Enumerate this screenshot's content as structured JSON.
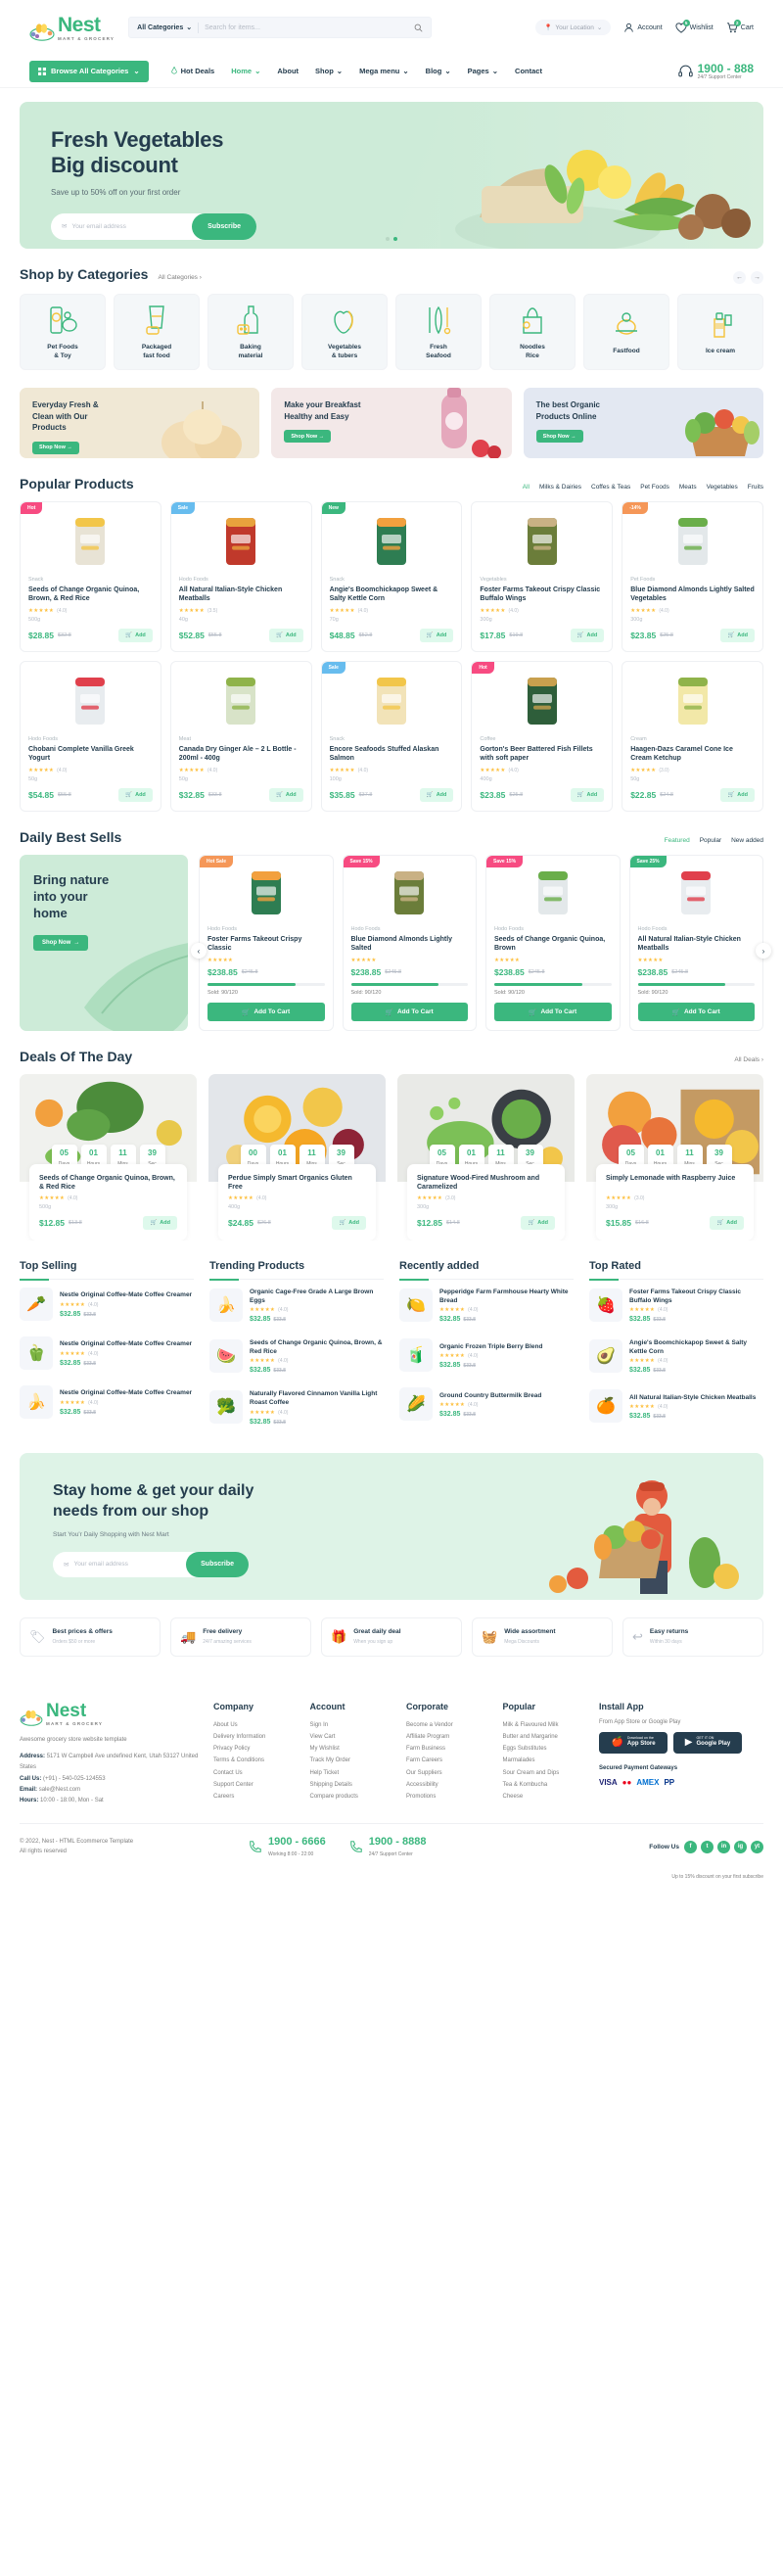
{
  "brand": {
    "name": "Nest",
    "tagline": "MART & GROCERY",
    "accent": "#3BB77E",
    "dark": "#253D4E"
  },
  "header": {
    "search": {
      "category": "All Categories",
      "placeholder": "Search for items..."
    },
    "location": "Your Location",
    "account": "Account",
    "wishlist": {
      "label": "Wishlist",
      "count": "5"
    },
    "cart": {
      "label": "Cart",
      "count": "2"
    }
  },
  "nav": {
    "browse": "Browse All Categories",
    "hot_deals": "Hot Deals",
    "items": [
      "Home",
      "About",
      "Shop",
      "Mega menu",
      "Blog",
      "Pages",
      "Contact"
    ],
    "phone": "1900 - 888",
    "phone_sub": "24/7 Support Center"
  },
  "hero": {
    "title_line1": "Fresh Vegetables",
    "title_line2": "Big discount",
    "subtitle": "Save up to 50% off on your first order",
    "email_placeholder": "Your email address",
    "subscribe": "Subscribe"
  },
  "categories_section": {
    "title": "Shop by Categories",
    "link": "All Categories",
    "items": [
      {
        "name": "Pet Foods\n& Toy",
        "icon": "pet-food-icon"
      },
      {
        "name": "Packaged\nfast food",
        "icon": "packaged-food-icon"
      },
      {
        "name": "Baking\nmaterial",
        "icon": "baking-icon"
      },
      {
        "name": "Vegetables\n& tubers",
        "icon": "vegetables-icon"
      },
      {
        "name": "Fresh\nSeafood",
        "icon": "seafood-icon"
      },
      {
        "name": "Noodles\nRice",
        "icon": "noodles-icon"
      },
      {
        "name": "Fastfood",
        "icon": "fastfood-icon"
      },
      {
        "name": "Ice cream",
        "icon": "icecream-icon"
      }
    ]
  },
  "promos": [
    {
      "title": "Everyday Fresh &\nClean with Our\nProducts",
      "button": "Shop Now",
      "bg": "#F0E8D5"
    },
    {
      "title": "Make your Breakfast\nHealthy and Easy",
      "button": "Shop Now",
      "bg": "#F3E8E8"
    },
    {
      "title": "The best Organic\nProducts Online",
      "button": "Shop Now",
      "bg": "#E3E8F2"
    }
  ],
  "popular": {
    "title": "Popular Products",
    "tabs": [
      "All",
      "Milks & Dairies",
      "Coffes & Teas",
      "Pet Foods",
      "Meats",
      "Vegetables",
      "Fruits"
    ],
    "active_tab": "All",
    "products": [
      {
        "tag": "Hot",
        "tag_color": "#F74B81",
        "cat": "Snack",
        "name": "Seeds of Change Organic Quinoa, Brown, & Red Rice",
        "stars": "★★★★★",
        "rating": "(4.0)",
        "weight": "500g",
        "price": "$28.85",
        "old": "$32.8"
      },
      {
        "tag": "Sale",
        "tag_color": "#67BCEE",
        "cat": "Hodo Foods",
        "name": "All Natural Italian-Style Chicken Meatballs",
        "stars": "★★★★★",
        "rating": "(3.5)",
        "weight": "40g",
        "price": "$52.85",
        "old": "$55.8"
      },
      {
        "tag": "New",
        "tag_color": "#3BB77E",
        "cat": "Snack",
        "name": "Angie's Boomchickapop Sweet & Salty Kettle Corn",
        "stars": "★★★★★",
        "rating": "(4.0)",
        "weight": "70g",
        "price": "$48.85",
        "old": "$52.8"
      },
      {
        "tag": "",
        "tag_color": "",
        "cat": "Vegetables",
        "name": "Foster Farms Takeout Crispy Classic Buffalo Wings",
        "stars": "★★★★★",
        "rating": "(4.0)",
        "weight": "300g",
        "price": "$17.85",
        "old": "$19.8"
      },
      {
        "tag": "-14%",
        "tag_color": "#F59758",
        "cat": "Pet Foods",
        "name": "Blue Diamond Almonds Lightly Salted Vegetables",
        "stars": "★★★★★",
        "rating": "(4.0)",
        "weight": "300g",
        "price": "$23.85",
        "old": "$25.8"
      },
      {
        "tag": "",
        "tag_color": "",
        "cat": "Hodo Foods",
        "name": "Chobani Complete Vanilla Greek Yogurt",
        "stars": "★★★★★",
        "rating": "(4.0)",
        "weight": "50g",
        "price": "$54.85",
        "old": "$55.8"
      },
      {
        "tag": "",
        "tag_color": "",
        "cat": "Meat",
        "name": "Canada Dry Ginger Ale – 2 L Bottle - 200ml - 400g",
        "stars": "★★★★★",
        "rating": "(4.0)",
        "weight": "50g",
        "price": "$32.85",
        "old": "$33.8"
      },
      {
        "tag": "Sale",
        "tag_color": "#67BCEE",
        "cat": "Snack",
        "name": "Encore Seafoods Stuffed Alaskan Salmon",
        "stars": "★★★★★",
        "rating": "(4.0)",
        "weight": "100g",
        "price": "$35.85",
        "old": "$37.8"
      },
      {
        "tag": "Hot",
        "tag_color": "#F74B81",
        "cat": "Coffee",
        "name": "Gorton's Beer Battered Fish Fillets with soft paper",
        "stars": "★★★★★",
        "rating": "(4.0)",
        "weight": "400g",
        "price": "$23.85",
        "old": "$25.8"
      },
      {
        "tag": "",
        "tag_color": "",
        "cat": "Cream",
        "name": "Haagen-Dazs Caramel Cone Ice Cream Ketchup",
        "stars": "★★★★★",
        "rating": "(3.0)",
        "weight": "50g",
        "price": "$22.85",
        "old": "$24.8"
      }
    ]
  },
  "daily": {
    "title": "Daily Best Sells",
    "tabs": [
      "Featured",
      "Popular",
      "New added"
    ],
    "active_tab": "Featured",
    "banner": {
      "title": "Bring nature\ninto your\nhome",
      "button": "Shop Now"
    },
    "products": [
      {
        "tag": "Hot Sale",
        "tag_color": "#F59758",
        "cat": "Hodo Foods",
        "name": "Foster Farms Takeout Crispy Classic",
        "stars": "★★★★★",
        "price": "$238.85",
        "old": "$245.8",
        "progress": 75,
        "sold": "Sold: 90/120",
        "button": "Add To Cart"
      },
      {
        "tag": "Save 15%",
        "tag_color": "#F74B81",
        "cat": "Hodo Foods",
        "name": "Blue Diamond Almonds Lightly Salted",
        "stars": "★★★★★",
        "price": "$238.85",
        "old": "$245.8",
        "progress": 75,
        "sold": "Sold: 90/120",
        "button": "Add To Cart"
      },
      {
        "tag": "Save 15%",
        "tag_color": "#F74B81",
        "cat": "Hodo Foods",
        "name": "Seeds of Change Organic Quinoa, Brown",
        "stars": "★★★★★",
        "price": "$238.85",
        "old": "$245.8",
        "progress": 75,
        "sold": "Sold: 90/120",
        "button": "Add To Cart"
      },
      {
        "tag": "Save 25%",
        "tag_color": "#3BB77E",
        "cat": "Hodo Foods",
        "name": "All Natural Italian-Style Chicken Meatballs",
        "stars": "★★★★★",
        "price": "$238.85",
        "old": "$245.8",
        "progress": 75,
        "sold": "Sold: 90/120",
        "button": "Add To Cart"
      }
    ]
  },
  "deals": {
    "title": "Deals Of The Day",
    "link": "All Deals",
    "items": [
      {
        "days": "05",
        "hours": "01",
        "mins": "11",
        "sec": "39",
        "name": "Seeds of Change Organic Quinoa, Brown, & Red Rice",
        "cat": "",
        "stars": "★★★★★",
        "rating": "(4.0)",
        "weight": "500g",
        "price": "$12.85",
        "old": "$13.8"
      },
      {
        "days": "00",
        "hours": "01",
        "mins": "11",
        "sec": "39",
        "name": "Perdue Simply Smart Organics Gluten Free",
        "cat": "",
        "stars": "★★★★★",
        "rating": "(4.0)",
        "weight": "400g",
        "price": "$24.85",
        "old": "$26.8"
      },
      {
        "days": "05",
        "hours": "01",
        "mins": "11",
        "sec": "39",
        "name": "Signature Wood-Fired Mushroom and Caramelized",
        "cat": "",
        "stars": "★★★★★",
        "rating": "(3.0)",
        "weight": "300g",
        "price": "$12.85",
        "old": "$14.8"
      },
      {
        "days": "05",
        "hours": "01",
        "mins": "11",
        "sec": "39",
        "name": "Simply Lemonade with Raspberry Juice",
        "cat": "",
        "stars": "★★★★★",
        "rating": "(3.0)",
        "weight": "300g",
        "price": "$15.85",
        "old": "$16.8"
      }
    ],
    "labels": {
      "days": "Days",
      "hours": "Hours",
      "mins": "Mins",
      "sec": "Sec"
    }
  },
  "lists": [
    {
      "title": "Top Selling",
      "items": [
        {
          "name": "Nestle Original Coffee-Mate Coffee Creamer",
          "stars": "★★★★★",
          "rating": "(4.0)",
          "price": "$32.85",
          "old": "$33.8",
          "emoji": "🥕"
        },
        {
          "name": "Nestle Original Coffee-Mate Coffee Creamer",
          "stars": "★★★★★",
          "rating": "(4.0)",
          "price": "$32.85",
          "old": "$33.8",
          "emoji": "🫑"
        },
        {
          "name": "Nestle Original Coffee-Mate Coffee Creamer",
          "stars": "★★★★★",
          "rating": "(4.0)",
          "price": "$32.85",
          "old": "$33.8",
          "emoji": "🍌"
        }
      ]
    },
    {
      "title": "Trending Products",
      "items": [
        {
          "name": "Organic Cage-Free Grade A Large Brown Eggs",
          "stars": "★★★★★",
          "rating": "(4.0)",
          "price": "$32.85",
          "old": "$33.8",
          "emoji": "🍌"
        },
        {
          "name": "Seeds of Change Organic Quinoa, Brown, & Red Rice",
          "stars": "★★★★★",
          "rating": "(4.0)",
          "price": "$32.85",
          "old": "$33.8",
          "emoji": "🍉"
        },
        {
          "name": "Naturally Flavored Cinnamon Vanilla Light Roast Coffee",
          "stars": "★★★★★",
          "rating": "(4.0)",
          "price": "$32.85",
          "old": "$33.8",
          "emoji": "🥦"
        }
      ]
    },
    {
      "title": "Recently added",
      "items": [
        {
          "name": "Pepperidge Farm Farmhouse Hearty White Bread",
          "stars": "★★★★★",
          "rating": "(4.0)",
          "price": "$32.85",
          "old": "$33.8",
          "emoji": "🍋"
        },
        {
          "name": "Organic Frozen Triple Berry Blend",
          "stars": "★★★★★",
          "rating": "(4.0)",
          "price": "$32.85",
          "old": "$33.8",
          "emoji": "🧃"
        },
        {
          "name": "Ground Country Buttermilk Bread",
          "stars": "★★★★★",
          "rating": "(4.0)",
          "price": "$32.85",
          "old": "$33.8",
          "emoji": "🌽"
        }
      ]
    },
    {
      "title": "Top Rated",
      "items": [
        {
          "name": "Foster Farms Takeout Crispy Classic Buffalo Wings",
          "stars": "★★★★★",
          "rating": "(4.0)",
          "price": "$32.85",
          "old": "$33.8",
          "emoji": "🍓"
        },
        {
          "name": "Angie's Boomchickapop Sweet & Salty Kettle Corn",
          "stars": "★★★★★",
          "rating": "(4.0)",
          "price": "$32.85",
          "old": "$33.8",
          "emoji": "🥑"
        },
        {
          "name": "All Natural Italian-Style Chicken Meatballs",
          "stars": "★★★★★",
          "rating": "(4.0)",
          "price": "$32.85",
          "old": "$33.8",
          "emoji": "🍊"
        }
      ]
    }
  ],
  "cta": {
    "title_line1": "Stay home & get your daily",
    "title_line2": "needs from our shop",
    "subtitle": "Start You'r Daily Shopping with Nest Mart",
    "email_placeholder": "Your email address",
    "subscribe": "Subscribe"
  },
  "features": [
    {
      "title": "Best prices & offers",
      "sub": "Orders $50 or more",
      "icon": "price-tag-icon"
    },
    {
      "title": "Free delivery",
      "sub": "24/7 amazing services",
      "icon": "truck-icon"
    },
    {
      "title": "Great daily deal",
      "sub": "When you sign up",
      "icon": "deal-icon"
    },
    {
      "title": "Wide assortment",
      "sub": "Mega Discounts",
      "icon": "grid-icon"
    },
    {
      "title": "Easy returns",
      "sub": "Within 30 days",
      "icon": "return-icon"
    }
  ],
  "footer": {
    "about_title": "Awesome grocery store website template",
    "address_label": "Address:",
    "address": "5171 W Campbell Ave undefined Kent, Utah 53127 United States",
    "phone_label": "Call Us:",
    "phone": "(+91) - 540-025-124553",
    "email_label": "Email:",
    "email": "sale@Nest.com",
    "hours_label": "Hours:",
    "hours": "10:00 - 18:00, Mon - Sat",
    "columns": [
      {
        "title": "Company",
        "links": [
          "About Us",
          "Delivery Information",
          "Privacy Policy",
          "Terms & Conditions",
          "Contact Us",
          "Support Center",
          "Careers"
        ]
      },
      {
        "title": "Account",
        "links": [
          "Sign In",
          "View Cart",
          "My Wishlist",
          "Track My Order",
          "Help Ticket",
          "Shipping Details",
          "Compare products"
        ]
      },
      {
        "title": "Corporate",
        "links": [
          "Become a Vendor",
          "Affiliate Program",
          "Farm Business",
          "Farm Careers",
          "Our Suppliers",
          "Accessibility",
          "Promotions"
        ]
      },
      {
        "title": "Popular",
        "links": [
          "Milk & Flavoured Milk",
          "Butter and Margarine",
          "Eggs Substitutes",
          "Marmalades",
          "Sour Cream and Dips",
          "Tea & Kombucha",
          "Cheese"
        ]
      }
    ],
    "install_title": "Install App",
    "install_sub": "From App Store or Google Play",
    "appstore": {
      "small": "Download on the",
      "big": "App Store"
    },
    "googleplay": {
      "small": "GET IT ON",
      "big": "Google Play"
    },
    "secured_title": "Secured Payment Gateways",
    "copyright": "© 2022, Nest - HTML Ecommerce Template",
    "rights": "All rights reserved",
    "phone1": {
      "num": "1900 - 6666",
      "sub": "Working 8:00 - 22:00"
    },
    "phone2": {
      "num": "1900 - 8888",
      "sub": "24/7 Support Center"
    },
    "follow_title": "Follow Us",
    "socials": [
      "f",
      "t",
      "in",
      "ig",
      "yt"
    ],
    "follow_sub": "Up to 15% discount on your first subscribe"
  }
}
